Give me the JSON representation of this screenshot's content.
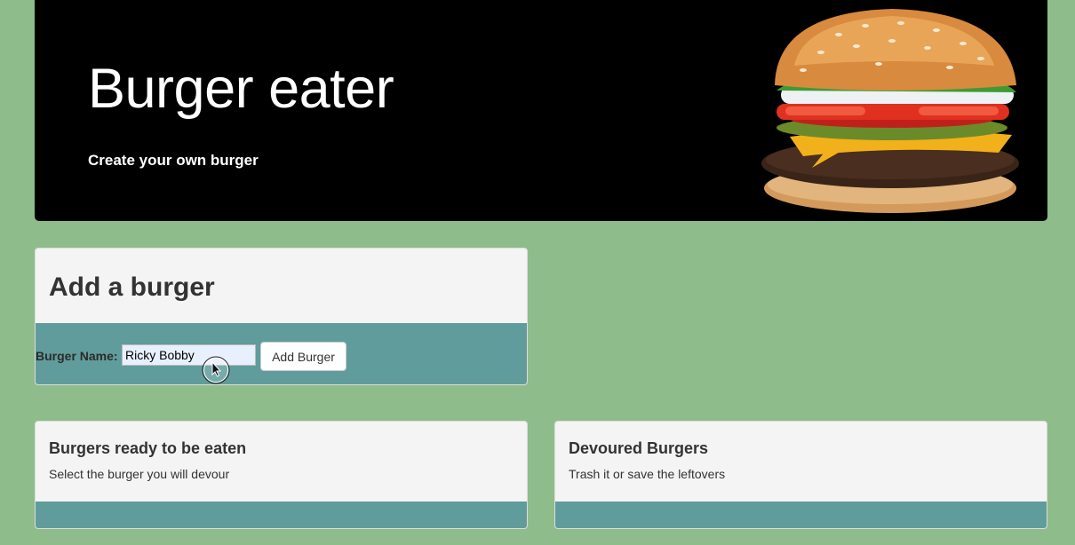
{
  "header": {
    "title": "Burger eater",
    "tagline": "Create your own burger",
    "image_icon": "burger-image"
  },
  "add_panel": {
    "title": "Add a burger",
    "field_label": "Burger Name:",
    "field_value": "Ricky Bobby",
    "button_label": "Add Burger"
  },
  "ready_panel": {
    "title": "Burgers ready to be eaten",
    "subtitle": "Select the burger you will devour"
  },
  "devoured_panel": {
    "title": "Devoured Burgers",
    "subtitle": "Trash it or save the leftovers"
  },
  "colors": {
    "page_background": "#8fbc8b",
    "header_background": "#000000",
    "panel_heading": "#f4f4f4",
    "panel_body": "#619c9c"
  }
}
